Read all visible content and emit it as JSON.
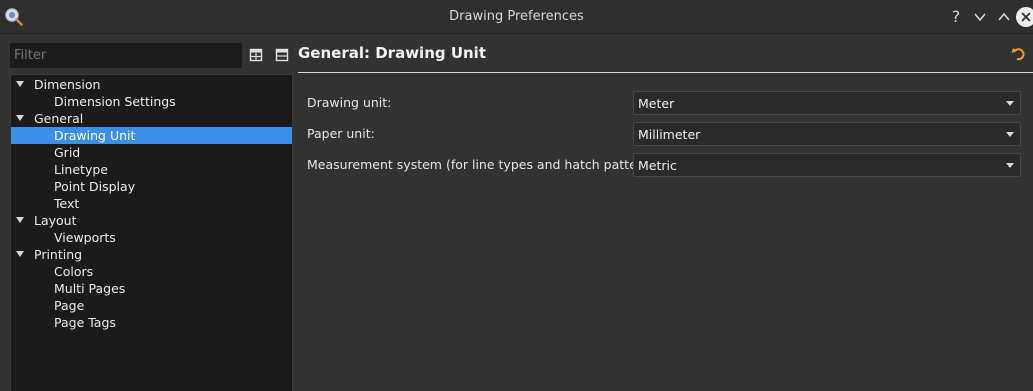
{
  "window": {
    "title": "Drawing Preferences",
    "app_icon": "magnifier-app-icon",
    "controls": {
      "help": "?",
      "minimize": "∨",
      "maximize": "∧",
      "close": "✕"
    }
  },
  "sidebar": {
    "filter_placeholder": "Filter",
    "expand_all_icon": "expand-all-icon",
    "collapse_all_icon": "collapse-all-icon",
    "tree": [
      {
        "label": "Dimension",
        "level": 0,
        "expanded": true
      },
      {
        "label": "Dimension Settings",
        "level": 1
      },
      {
        "label": "General",
        "level": 0,
        "expanded": true
      },
      {
        "label": "Drawing Unit",
        "level": 1,
        "selected": true
      },
      {
        "label": "Grid",
        "level": 1
      },
      {
        "label": "Linetype",
        "level": 1
      },
      {
        "label": "Point Display",
        "level": 1
      },
      {
        "label": "Text",
        "level": 1
      },
      {
        "label": "Layout",
        "level": 0,
        "expanded": true
      },
      {
        "label": "Viewports",
        "level": 1
      },
      {
        "label": "Printing",
        "level": 0,
        "expanded": true
      },
      {
        "label": "Colors",
        "level": 1
      },
      {
        "label": "Multi Pages",
        "level": 1
      },
      {
        "label": "Page",
        "level": 1
      },
      {
        "label": "Page Tags",
        "level": 1
      }
    ]
  },
  "main": {
    "header": "General: Drawing Unit",
    "revert_icon": "revert-icon",
    "fields": [
      {
        "label": "Drawing unit:",
        "value": "Meter"
      },
      {
        "label": "Paper unit:",
        "value": "Millimeter"
      },
      {
        "label": "Measurement system (for line types and hatch patterns):",
        "value": "Metric"
      }
    ]
  },
  "colors": {
    "selection": "#3d8ee6",
    "revert_icon": "#f0a020"
  }
}
